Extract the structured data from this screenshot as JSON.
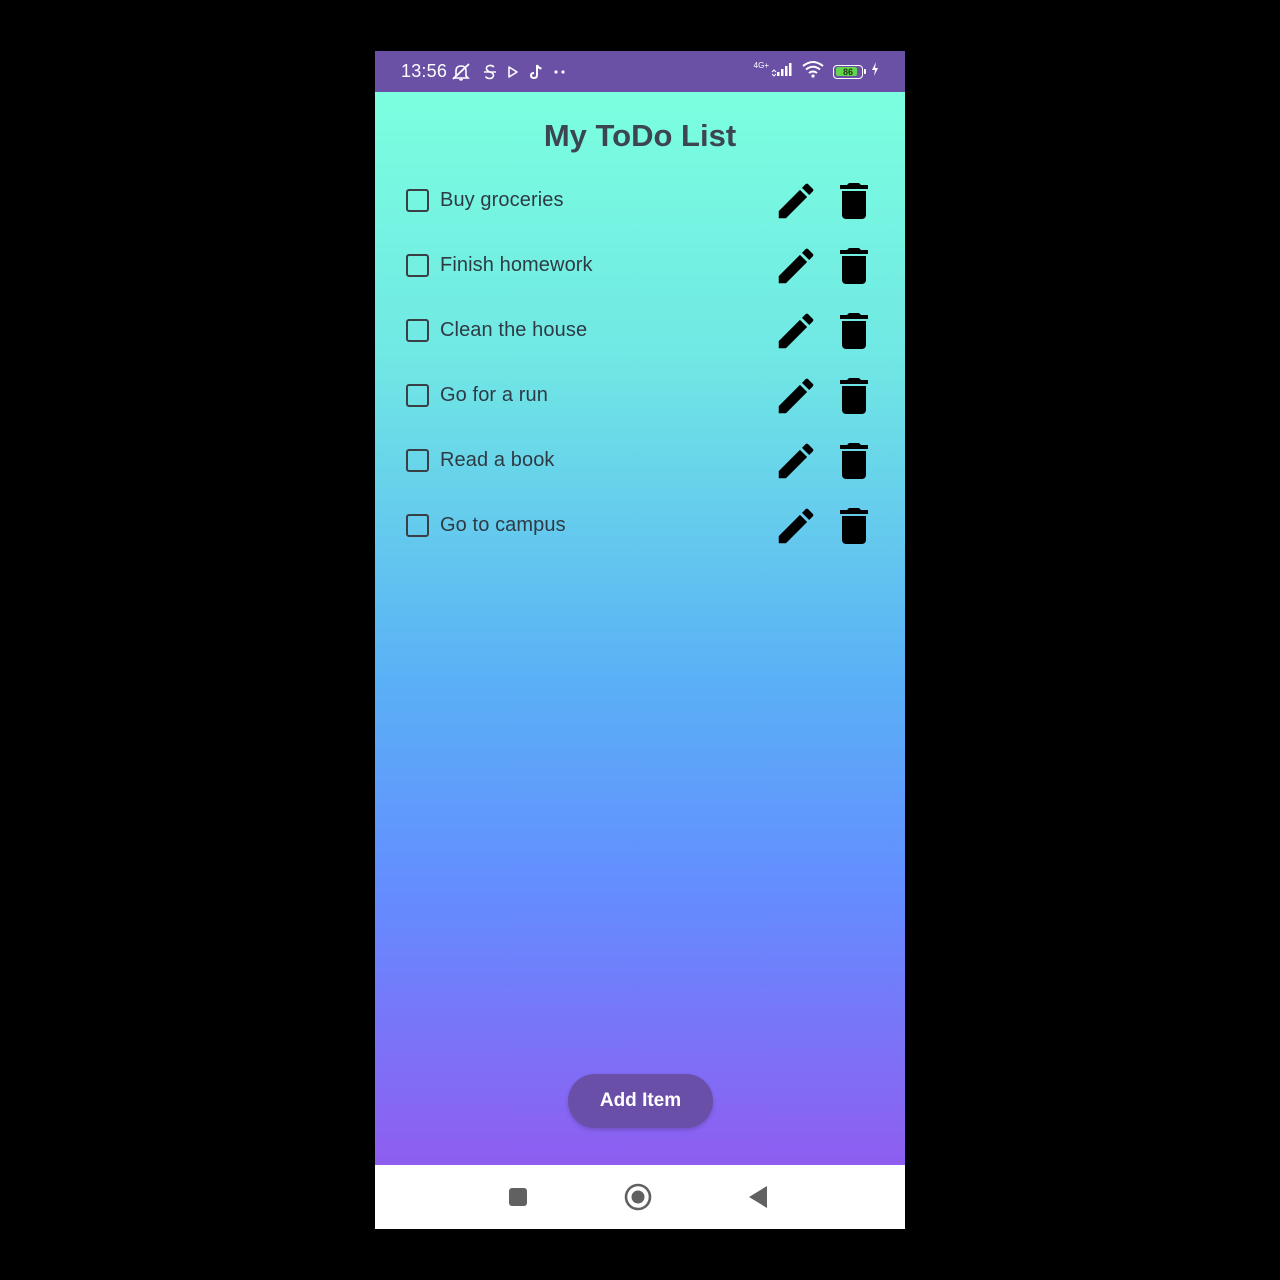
{
  "status_bar": {
    "time": "13:56",
    "network_label": "4G+",
    "battery_level": "86",
    "battery_fraction": 0.86,
    "left_icons": [
      "mute-icon",
      "s-app-icon",
      "play-icon",
      "tiktok-icon",
      "more-dots-icon"
    ],
    "right_icons": [
      "signal-icon",
      "wifi-icon",
      "battery-icon",
      "charging-icon"
    ]
  },
  "app": {
    "title": "My ToDo List",
    "add_button_label": "Add Item",
    "colors": {
      "gradient_top": "#7bffdf",
      "gradient_bottom": "#8f5df1",
      "accent": "#6a4fa8",
      "status_bar": "#6a51a6"
    }
  },
  "todos": [
    {
      "label": "Buy groceries",
      "checked": false
    },
    {
      "label": "Finish homework",
      "checked": false
    },
    {
      "label": "Clean the house",
      "checked": false
    },
    {
      "label": "Go for a run",
      "checked": false
    },
    {
      "label": "Read a book",
      "checked": false
    },
    {
      "label": "Go to campus",
      "checked": false
    }
  ],
  "navigation": {
    "buttons": [
      "recents-square-icon",
      "home-circle-icon",
      "back-triangle-icon"
    ]
  }
}
